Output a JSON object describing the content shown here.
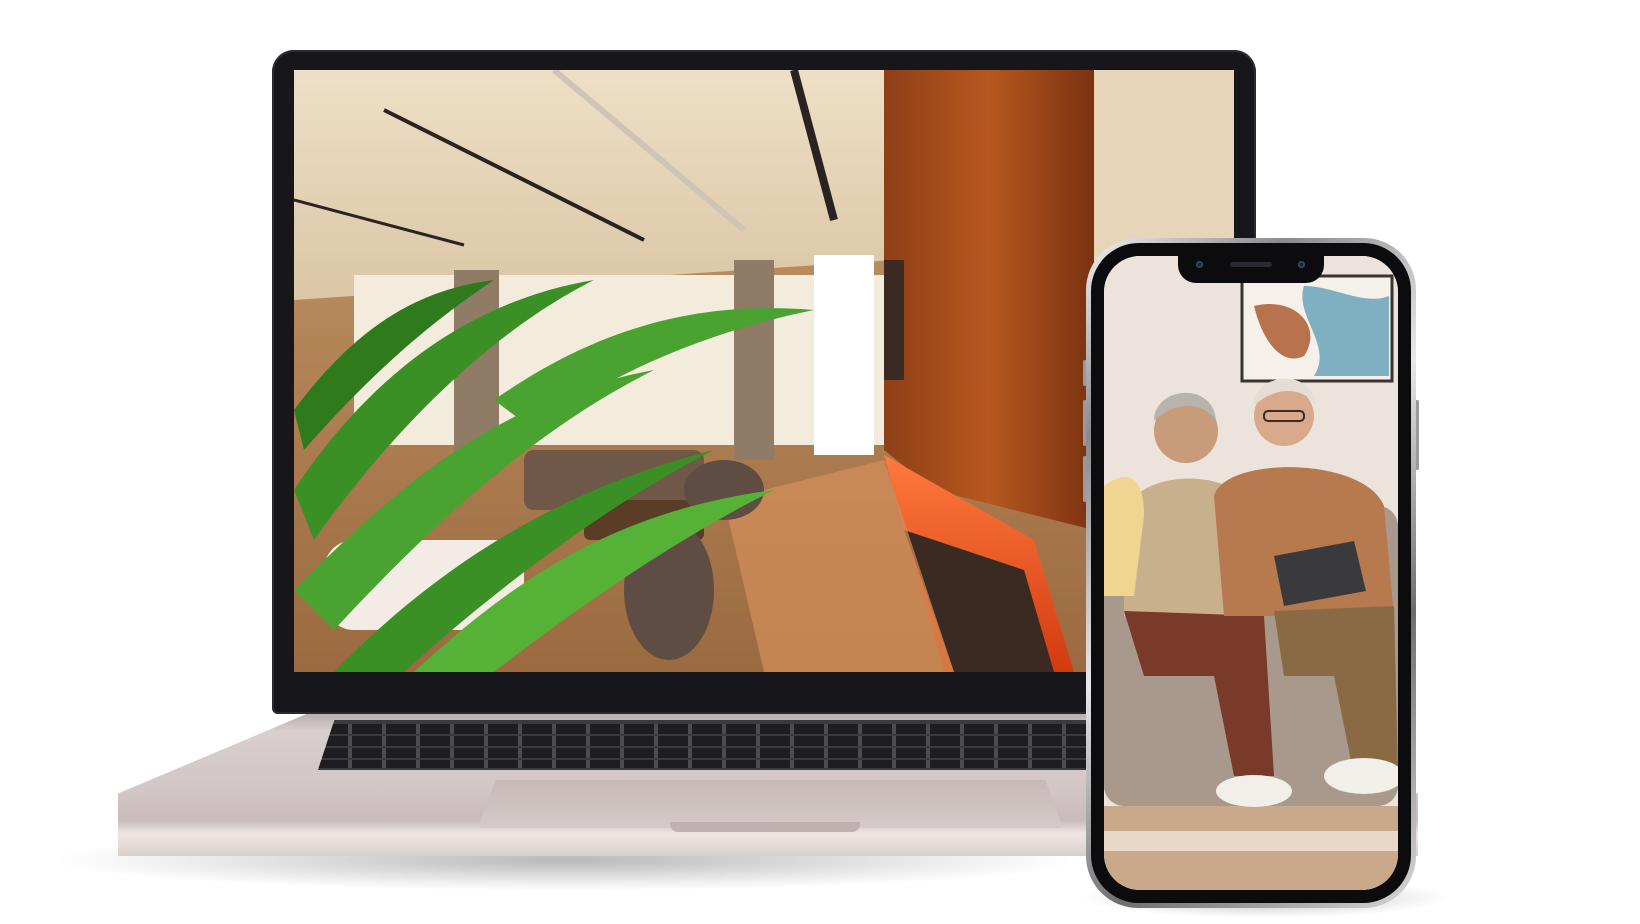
{
  "scene": {
    "laptop": {
      "screen_content": "interior-living-room-photo",
      "frame_color": "#17161b",
      "body_color": "#d6cbca"
    },
    "phone": {
      "screen_content": "elderly-couple-with-tablet-photo",
      "frame_color": "#0c0c0e"
    },
    "colors": {
      "background": "#ffffff",
      "wood": "#b6581f",
      "palm": "#3a8f25",
      "ceiling": "#e9d9c0"
    }
  }
}
